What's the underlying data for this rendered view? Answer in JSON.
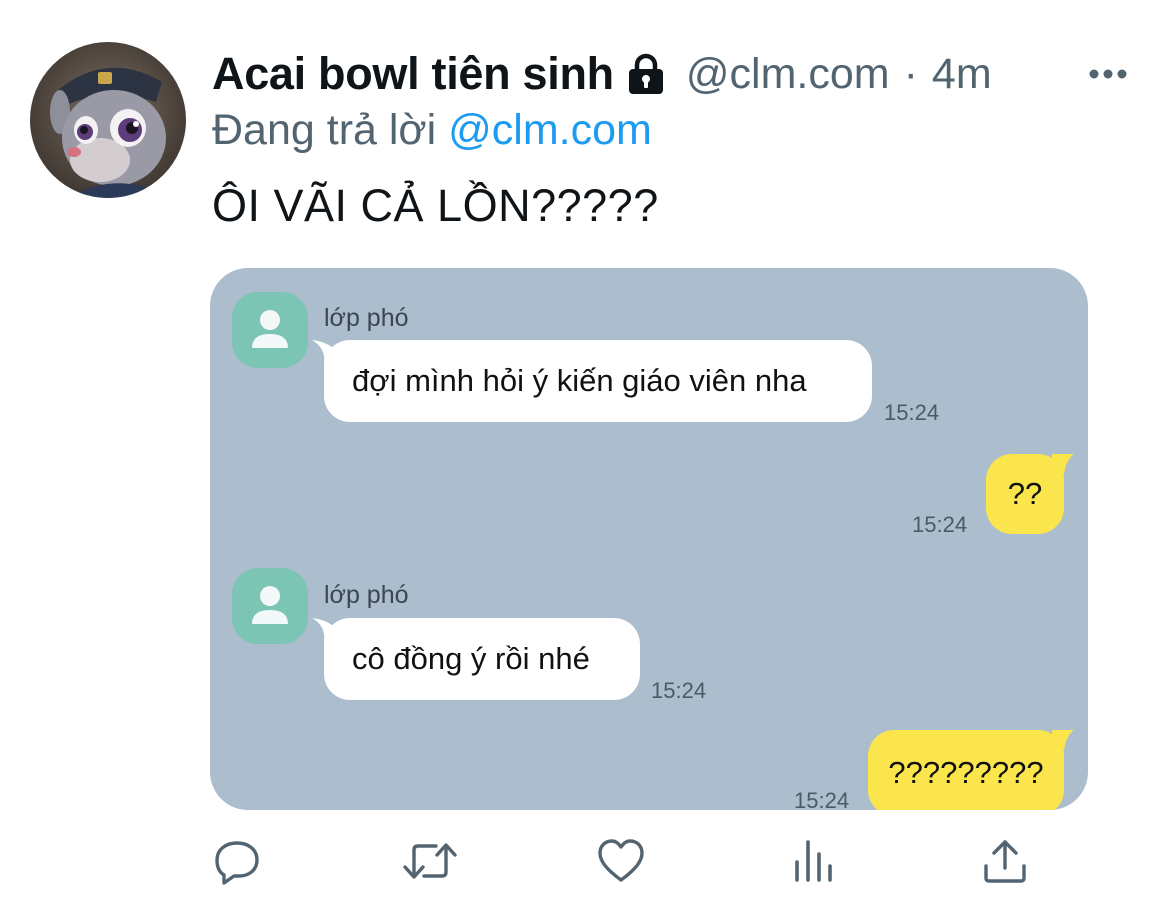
{
  "tweet": {
    "author_name": "Acai bowl tiên sinh",
    "handle": "@clm.com",
    "separator": "·",
    "time": "4m",
    "reply_prefix": "Đang trả lời",
    "reply_to": "@clm.com",
    "text": "ÔI VÃI CẢ LỒN?????"
  },
  "chat": {
    "messages": [
      {
        "sender": "lớp phó",
        "text": "đợi mình hỏi ý kiến giáo viên nha",
        "time": "15:24"
      },
      {
        "text": "??",
        "time": "15:24"
      },
      {
        "sender": "lớp phó",
        "text": "cô đồng ý rồi nhé",
        "time": "15:24"
      },
      {
        "text": "?????????",
        "time": "15:24"
      }
    ],
    "colors": {
      "background": "#acbdcd",
      "incoming_bubble": "#ffffff",
      "outgoing_bubble": "#fae54c",
      "avatar": "#7cc4b3"
    }
  },
  "icons": {
    "lock": "lock-icon",
    "more": "more-icon",
    "reply": "reply-icon",
    "retweet": "retweet-icon",
    "like": "like-icon",
    "stats": "stats-icon",
    "share": "share-icon"
  },
  "colors": {
    "primary_text": "#0f1419",
    "secondary_text": "#536471",
    "link": "#1d9bf0"
  }
}
